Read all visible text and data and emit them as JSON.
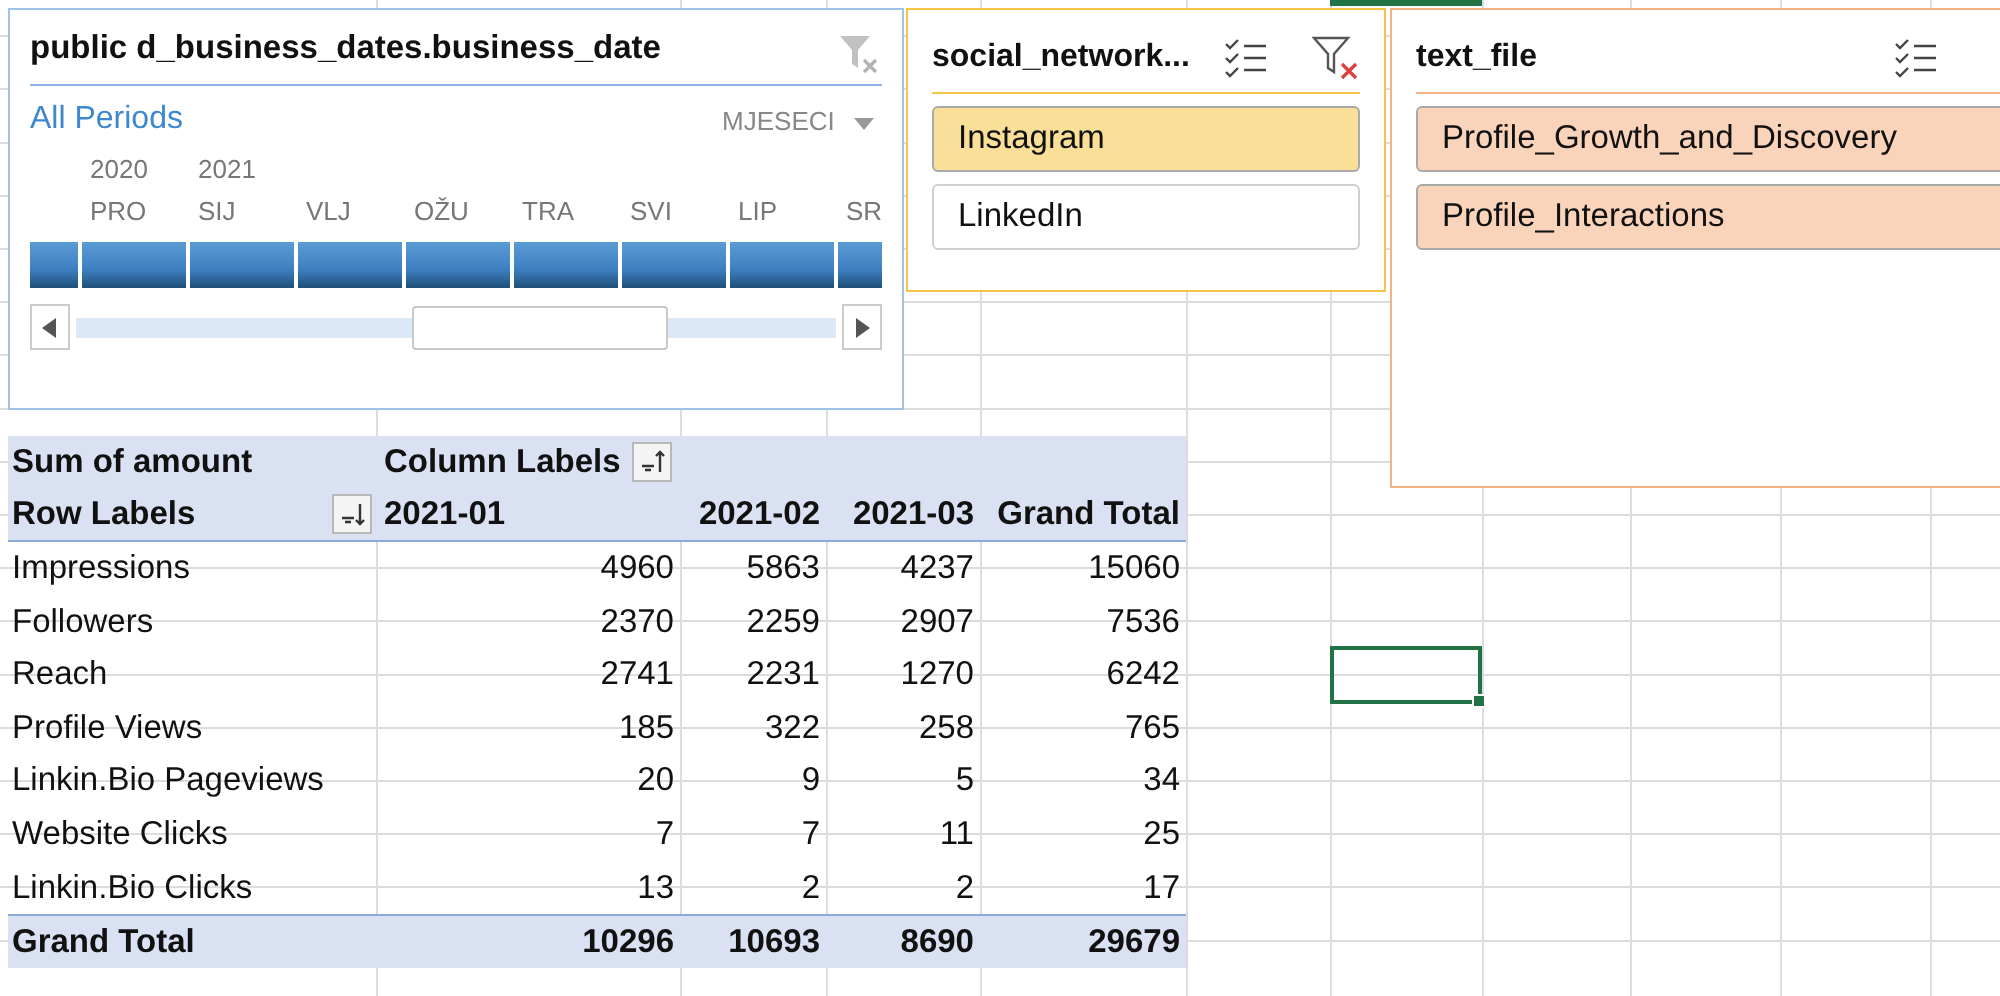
{
  "timeline": {
    "title": "public d_business_dates.business_date",
    "clear_filter": {
      "disabled": true
    },
    "period": "All Periods",
    "level_label": "MJESECI",
    "months": [
      {
        "year": "2020",
        "label": "PRO",
        "selected": true
      },
      {
        "year": "2021",
        "label": "SIJ",
        "selected": true
      },
      {
        "label": "VLJ",
        "selected": true
      },
      {
        "label": "OŽU",
        "selected": true
      },
      {
        "label": "TRA",
        "selected": true
      },
      {
        "label": "SVI",
        "selected": true
      },
      {
        "label": "LIP",
        "selected": true
      },
      {
        "label": "SR",
        "selected": true
      }
    ]
  },
  "slicers": [
    {
      "title": "social_network...",
      "color": "#f5c543",
      "clear_filter": {
        "disabled": false
      },
      "items": [
        {
          "label": "Instagram",
          "selected": true
        },
        {
          "label": "LinkedIn",
          "selected": false
        }
      ]
    },
    {
      "title": "text_file",
      "color": "#f4b183",
      "items": [
        {
          "label": "Profile_Growth_and_Discovery",
          "selected": true
        },
        {
          "label": "Profile_Interactions",
          "selected": true
        }
      ]
    }
  ],
  "pivot": {
    "value_label": "Sum of amount",
    "column_labels": "Column Labels",
    "row_labels": "Row Labels",
    "columns": [
      "2021-01",
      "2021-02",
      "2021-03",
      "Grand Total"
    ],
    "rows": [
      {
        "label": "Impressions",
        "values": [
          "4960",
          "5863",
          "4237",
          "15060"
        ]
      },
      {
        "label": "Followers",
        "values": [
          "2370",
          "2259",
          "2907",
          "7536"
        ]
      },
      {
        "label": "Reach",
        "values": [
          "2741",
          "2231",
          "1270",
          "6242"
        ]
      },
      {
        "label": "Profile Views",
        "values": [
          "185",
          "322",
          "258",
          "765"
        ]
      },
      {
        "label": "Linkin.Bio Pageviews",
        "values": [
          "20",
          "9",
          "5",
          "34"
        ]
      },
      {
        "label": "Website Clicks",
        "values": [
          "7",
          "7",
          "11",
          "25"
        ]
      },
      {
        "label": "Linkin.Bio Clicks",
        "values": [
          "13",
          "2",
          "2",
          "17"
        ]
      }
    ],
    "total": {
      "label": "Grand Total",
      "values": [
        "10296",
        "10693",
        "8690",
        "29679"
      ]
    }
  }
}
